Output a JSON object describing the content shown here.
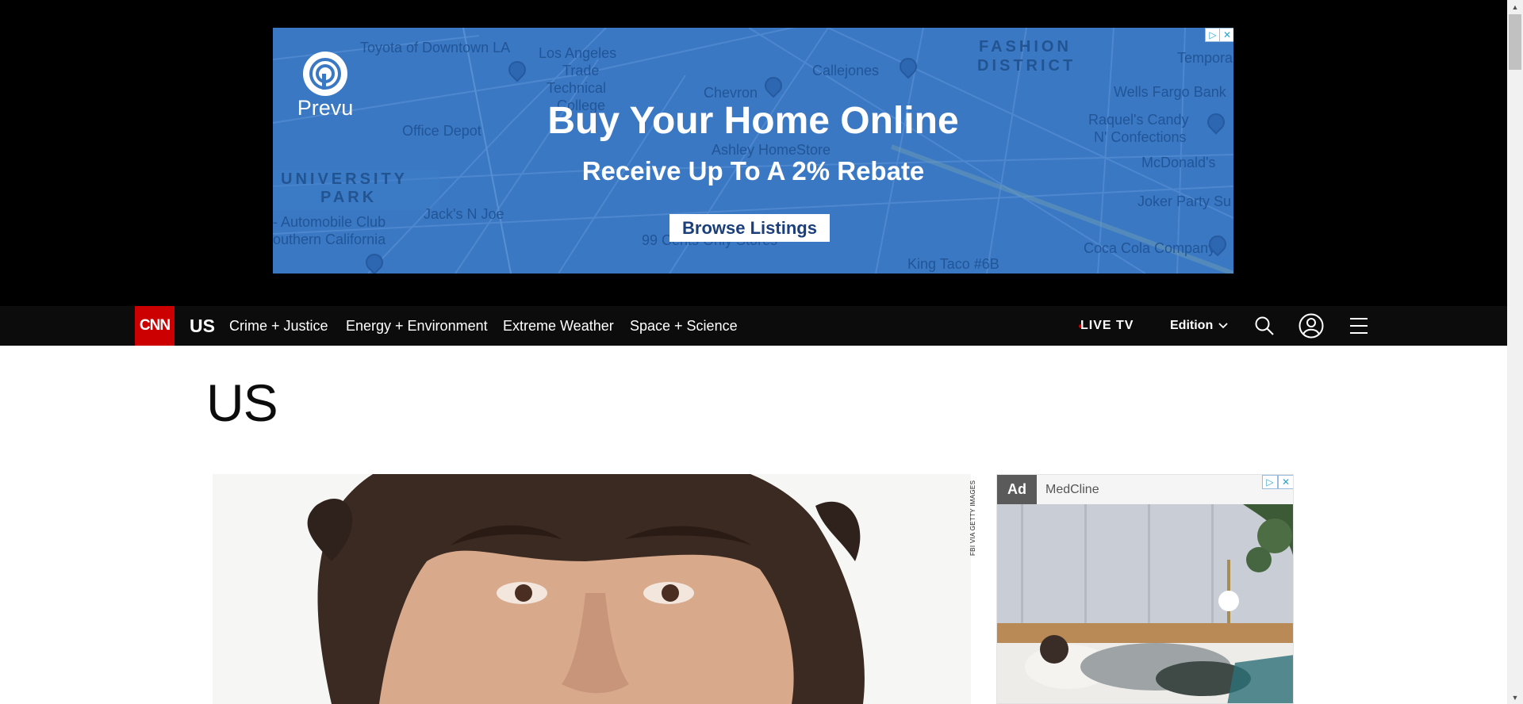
{
  "top_ad": {
    "brand": "Prevu",
    "headline": "Buy Your Home Online",
    "subline": "Receive Up To A 2% Rebate",
    "cta": "Browse Listings",
    "map_labels": {
      "toyota": "Toyota of Downtown LA",
      "los_angeles": "Los Angeles",
      "trade": "Trade",
      "technical": "Technical",
      "college": "College",
      "fashion": "FASHION",
      "district": "DISTRICT",
      "callejones": "Callejones",
      "chevron": "Chevron",
      "wells_fargo": "Wells Fargo Bank",
      "office_depot": "Office Depot",
      "ashley": "Ashley HomeStore",
      "raquels1": "Raquel's Candy",
      "raquels2": "N' Confections",
      "mcdonalds": "McDonald's",
      "university": "UNIVERSITY",
      "park": "PARK",
      "joker": "Joker Party Su",
      "automobile1": "- Automobile Club",
      "automobile2": "outhern California",
      "jacks": "Jack's N Joe",
      "ninety_nine": "99 Cents Only Stores",
      "coca_cola": "Coca Cola Company",
      "king_taco": "King Taco #6B",
      "temporary": "Temporar"
    }
  },
  "nav": {
    "logo": "CNN",
    "section": "US",
    "links": [
      "Crime + Justice",
      "Energy + Environment",
      "Extreme Weather",
      "Space + Science"
    ],
    "live_tv": "LIVE TV",
    "edition": "Edition"
  },
  "page": {
    "title": "US",
    "hero_credit": "FBI VIA GETTY IMAGES"
  },
  "side_ad": {
    "tag": "Ad",
    "sponsor": "MedCline"
  },
  "colors": {
    "cnn_red": "#cc0000",
    "nav_bg": "#0c0c0c",
    "ad_blue": "#3a78c4"
  },
  "icons": {
    "search": "search-icon",
    "account": "user-account-icon",
    "menu": "hamburger-menu-icon",
    "chevron": "chevron-down-icon",
    "adchoices": "adchoices-icon",
    "close": "close-icon"
  }
}
